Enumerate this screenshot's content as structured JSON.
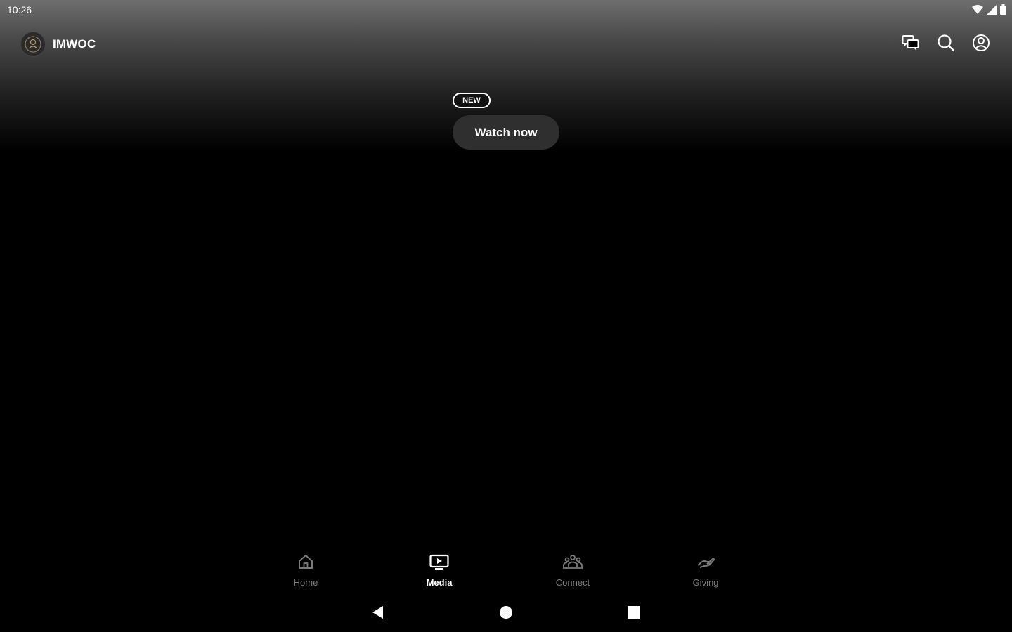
{
  "status_bar": {
    "time": "10:26"
  },
  "header": {
    "app_name": "IMWOC"
  },
  "hero": {
    "badge": "NEW",
    "cta_label": "Watch now"
  },
  "bottom_nav": {
    "items": [
      {
        "label": "Home",
        "icon": "home-icon",
        "active": false
      },
      {
        "label": "Media",
        "icon": "media-icon",
        "active": true
      },
      {
        "label": "Connect",
        "icon": "connect-icon",
        "active": false
      },
      {
        "label": "Giving",
        "icon": "giving-icon",
        "active": false
      }
    ]
  },
  "colors": {
    "background": "#000000",
    "active_label": "#ffffff",
    "inactive_label": "#7a7a7a",
    "button_bg": "#2f2f2f"
  }
}
